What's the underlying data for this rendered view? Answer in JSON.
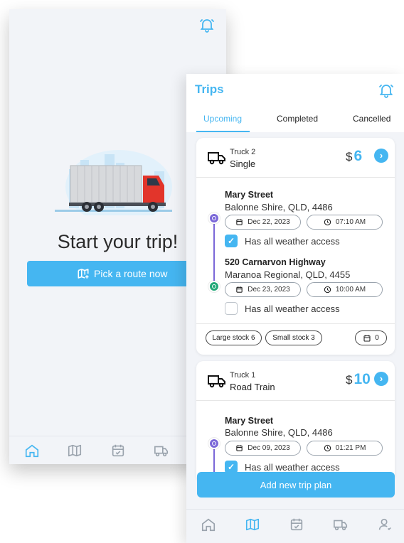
{
  "back_screen": {
    "title": "Start your trip!",
    "pick_route_label": "Pick a route now",
    "nav": [
      "home-icon",
      "map-icon",
      "calendar-icon",
      "truck-icon"
    ]
  },
  "front_screen": {
    "header_title": "Trips",
    "tabs": [
      {
        "label": "Upcoming",
        "active": true
      },
      {
        "label": "Completed",
        "active": false
      },
      {
        "label": "Cancelled",
        "active": false
      }
    ],
    "trips": [
      {
        "truck": "Truck 2",
        "type": "Single",
        "currency": "$",
        "price": "6",
        "stops": [
          {
            "name": "Mary Street",
            "address": "Balonne Shire, QLD, 4486",
            "date": "Dec 22, 2023",
            "time": "07:10 AM",
            "weather_checked": true,
            "weather_label": "Has all weather access"
          },
          {
            "name": "520 Carnarvon Highway",
            "address": "Maranoa Regional, QLD, 4455",
            "date": "Dec 23, 2023",
            "time": "10:00 AM",
            "weather_checked": false,
            "weather_label": "Has all weather access"
          }
        ],
        "tags": [
          "Large stock 6",
          "Small stock 3"
        ],
        "booking_count": "0"
      },
      {
        "truck": "Truck 1",
        "type": "Road Train",
        "currency": "$",
        "price": "10",
        "stops": [
          {
            "name": "Mary Street",
            "address": "Balonne Shire, QLD, 4486",
            "date": "Dec 09, 2023",
            "time": "01:21 PM",
            "weather_checked": true,
            "weather_label": "Has all weather access"
          }
        ]
      }
    ],
    "add_button_label": "Add new trip plan",
    "nav": [
      "home-icon",
      "map-icon",
      "calendar-icon",
      "truck-icon",
      "user-icon"
    ]
  },
  "colors": {
    "accent": "#45b6f1",
    "route_start": "#7b68d8",
    "route_end": "#22a878",
    "background": "#f2f4f8"
  }
}
